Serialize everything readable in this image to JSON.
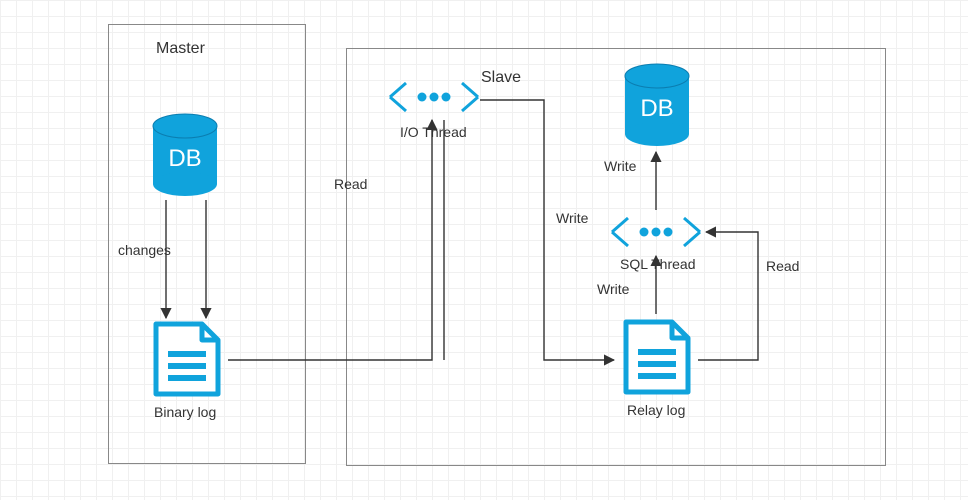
{
  "master": {
    "title": "Master",
    "db_label": "DB",
    "log_label": "Binary log",
    "edge_changes": "changes"
  },
  "slave": {
    "title": "Slave",
    "io_thread": "I/O Thread",
    "sql_thread": "SQL Thread",
    "db_label": "DB",
    "log_label": "Relay log",
    "edge_read_from_binlog": "Read",
    "edge_write_relay": "Write",
    "edge_write_relay2": "Write",
    "edge_read_relay": "Read",
    "edge_write_db": "Write"
  },
  "colors": {
    "accent": "#10a3dc",
    "border": "#888888"
  }
}
